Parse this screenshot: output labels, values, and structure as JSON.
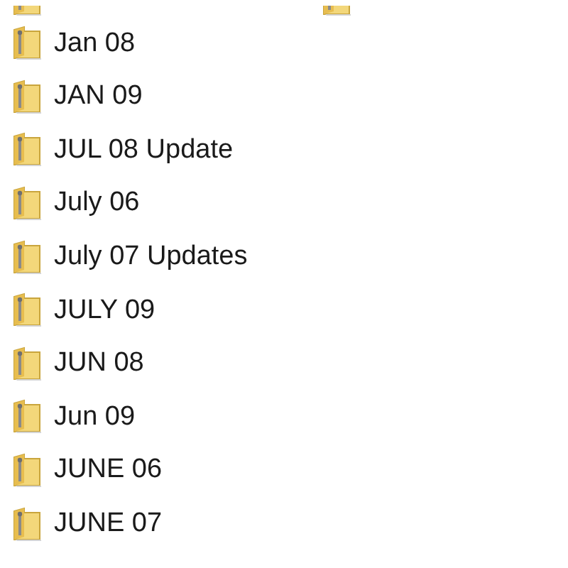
{
  "folders": [
    {
      "name": "Jan 08"
    },
    {
      "name": "JAN 09"
    },
    {
      "name": "JUL 08 Update"
    },
    {
      "name": "July 06"
    },
    {
      "name": "July 07 Updates"
    },
    {
      "name": "JULY 09"
    },
    {
      "name": "JUN 08"
    },
    {
      "name": "Jun 09"
    },
    {
      "name": "JUNE 06"
    },
    {
      "name": "JUNE 07"
    }
  ]
}
